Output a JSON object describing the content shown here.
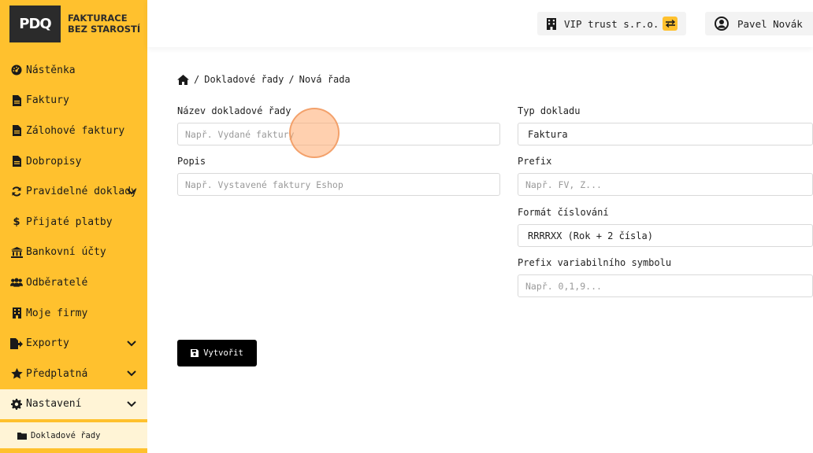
{
  "logo": {
    "mark": "PDQ",
    "tagline": "FAKTURACE BEZ STAROSTÍ"
  },
  "sidebar": {
    "items": [
      {
        "label": "Nástěnka",
        "icon": "dashboard-icon"
      },
      {
        "label": "Faktury",
        "icon": "file-icon"
      },
      {
        "label": "Zálohové faktury",
        "icon": "file-icon"
      },
      {
        "label": "Dobropisy",
        "icon": "file-icon"
      },
      {
        "label": "Pravidelné doklady",
        "icon": "sync-icon",
        "expandable": true
      },
      {
        "label": "Přijaté platby",
        "icon": "dollar-icon"
      },
      {
        "label": "Bankovní účty",
        "icon": "bank-icon"
      },
      {
        "label": "Odběratelé",
        "icon": "users-icon"
      },
      {
        "label": "Moje firmy",
        "icon": "building-icon"
      },
      {
        "label": "Exporty",
        "icon": "export-icon",
        "expandable": true
      },
      {
        "label": "Předplatná",
        "icon": "star-icon",
        "expandable": true
      },
      {
        "label": "Nastavení",
        "icon": "gear-icon",
        "expandable": true,
        "active": true
      }
    ],
    "subitems": [
      {
        "label": "Dokladové řady",
        "icon": "folder-icon"
      }
    ]
  },
  "header": {
    "company": "VIP trust s.r.o.",
    "user": "Pavel Novák"
  },
  "breadcrumb": {
    "items": [
      "Dokladové řady",
      "Nová řada"
    ],
    "separator": "/"
  },
  "form": {
    "name": {
      "label": "Název dokladové řady",
      "placeholder": "Např. Vydané faktury"
    },
    "description": {
      "label": "Popis",
      "placeholder": "Např. Vystavené faktury Eshop"
    },
    "doc_type": {
      "label": "Typ dokladu",
      "value": "Faktura"
    },
    "prefix": {
      "label": "Prefix",
      "placeholder": "Např. FV, Z..."
    },
    "numbering": {
      "label": "Formát číslování",
      "value": "RRRRXX (Rok + 2 čísla)"
    },
    "vs_prefix": {
      "label": "Prefix variabilního symbolu",
      "placeholder": "Např. 0,1,9..."
    },
    "submit_label": "Vytvořit"
  },
  "colors": {
    "accent": "#ffc12e",
    "dark": "#2b2b2b",
    "submit": "#000000"
  }
}
